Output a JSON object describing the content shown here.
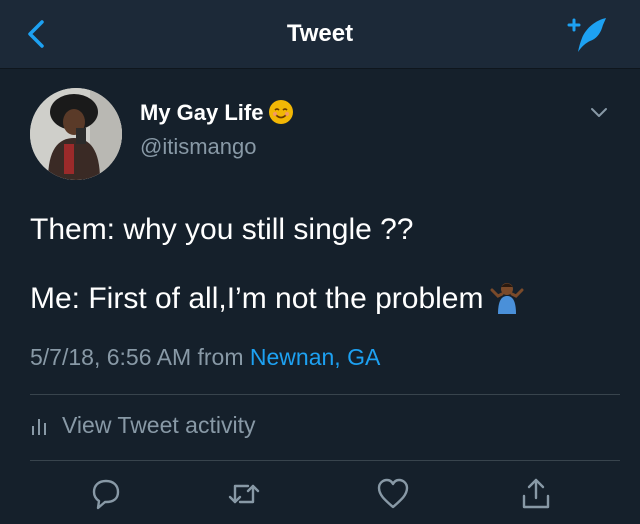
{
  "header": {
    "title": "Tweet",
    "back_icon": "chevron-left-icon",
    "compose_icon": "compose-tweet-icon",
    "accent": "#1da1f2"
  },
  "author": {
    "display_name": "My Gay Life",
    "name_emoji": "smiling-face-emoji",
    "handle": "@itismango"
  },
  "tweet": {
    "lines": [
      "Them: why you still single ??",
      "Me: First of all,I’m not the problem"
    ],
    "trailing_emoji": "person-shrugging-emoji",
    "timestamp": "5/7/18, 6:56 AM from",
    "location": "Newnan, GA"
  },
  "activity": {
    "label": "View Tweet activity"
  },
  "actions": [
    "reply-icon",
    "retweet-icon",
    "like-icon",
    "share-icon"
  ],
  "colors": {
    "background": "#15202b",
    "header_bg": "#1c2938",
    "secondary_text": "#8899a6",
    "divider": "#38444d"
  }
}
